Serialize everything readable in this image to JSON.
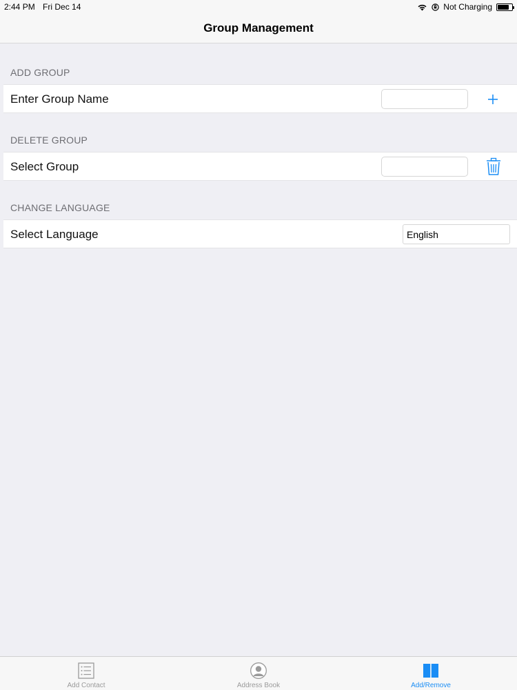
{
  "status_bar": {
    "time": "2:44 PM",
    "date": "Fri Dec 14",
    "charging": "Not Charging",
    "icons": [
      "wifi-icon",
      "lock-rotation-icon",
      "battery-icon"
    ]
  },
  "nav": {
    "title": "Group Management"
  },
  "sections": {
    "add": {
      "header": "ADD GROUP",
      "label": "Enter Group Name",
      "input_value": "",
      "action_icon": "plus-icon"
    },
    "delete": {
      "header": "DELETE GROUP",
      "label": "Select Group",
      "input_value": "",
      "action_icon": "trash-icon"
    },
    "language": {
      "header": "CHANGE LANGUAGE",
      "label": "Select Language",
      "selected": "English"
    }
  },
  "tabs": [
    {
      "label": "Add Contact",
      "icon": "list-icon",
      "active": false
    },
    {
      "label": "Address Book",
      "icon": "person-icon",
      "active": false
    },
    {
      "label": "Add/Remove",
      "icon": "book-icon",
      "active": true
    }
  ],
  "colors": {
    "accent": "#1a8df5",
    "background": "#efeff4",
    "inactive": "#9a9a9a"
  }
}
